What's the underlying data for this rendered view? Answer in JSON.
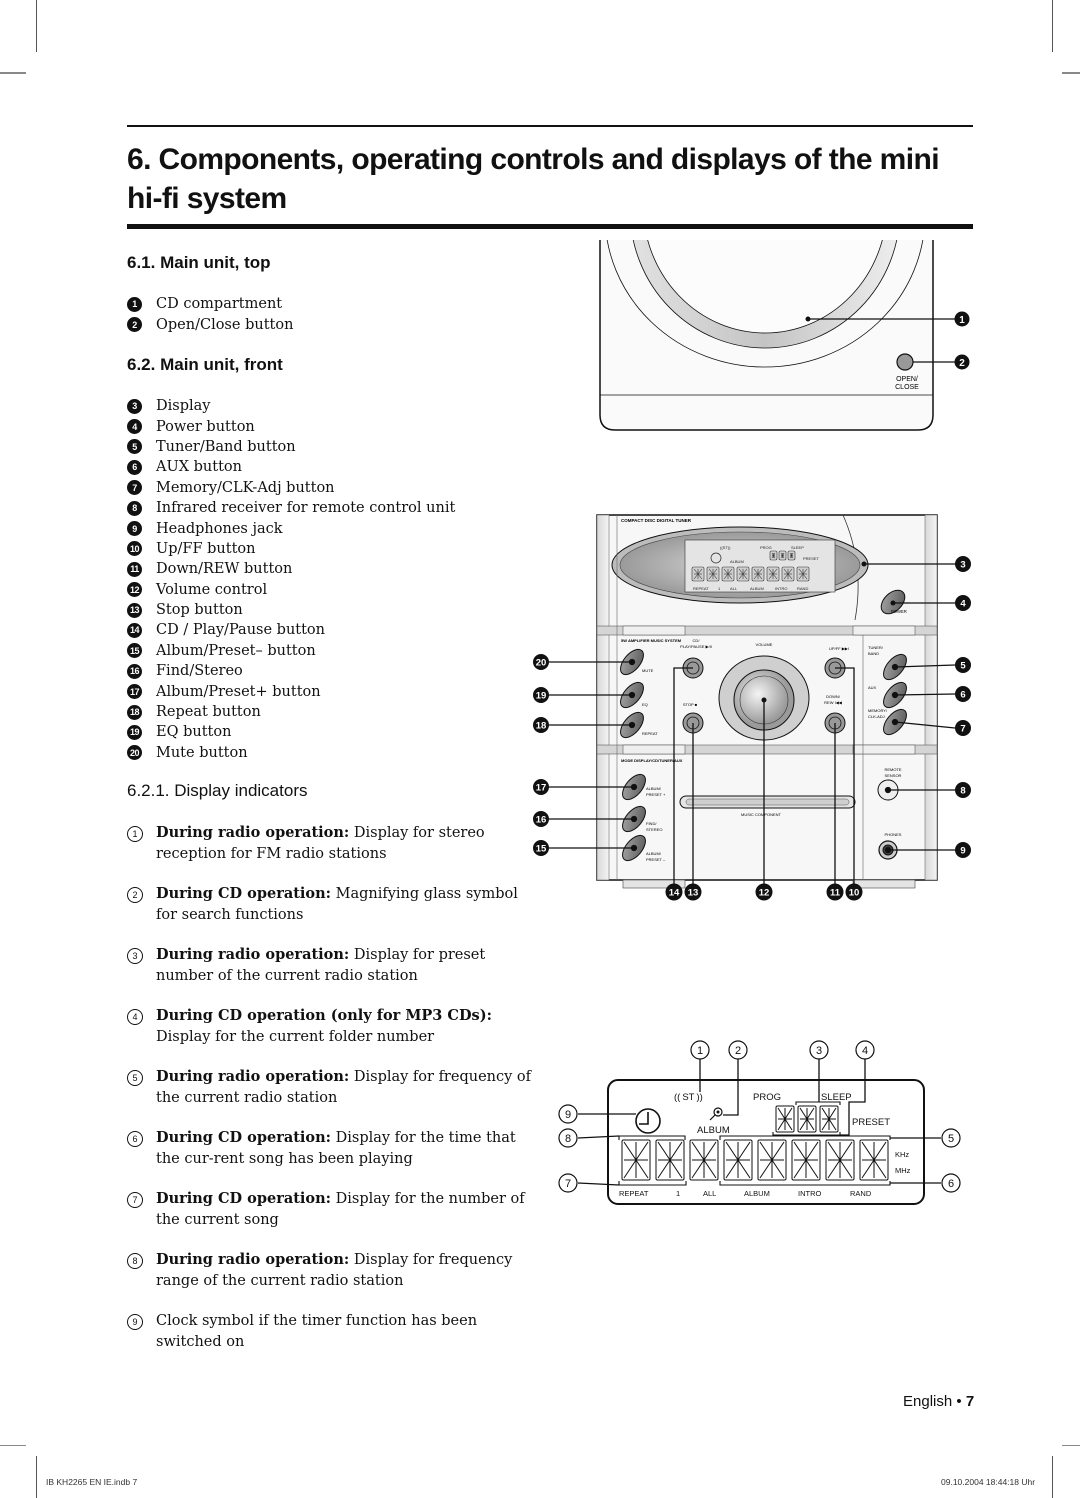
{
  "page": {
    "title": "6. Components, operating controls and displays of the mini hi-fi system",
    "footer": {
      "language": "English",
      "separator": "•",
      "page_number": "7"
    },
    "slug_left": "IB KH2265 EN IE.indb   7",
    "slug_right": "09.10.2004   18:44:18 Uhr"
  },
  "section_top": {
    "heading": "6.1. Main unit, top",
    "items": [
      {
        "num": "1",
        "label": "CD compartment"
      },
      {
        "num": "2",
        "label": "Open/Close button"
      }
    ]
  },
  "section_front": {
    "heading": "6.2. Main unit, front",
    "items": [
      {
        "num": "3",
        "label": "Display"
      },
      {
        "num": "4",
        "label": "Power button"
      },
      {
        "num": "5",
        "label": "Tuner/Band button"
      },
      {
        "num": "6",
        "label": "AUX button"
      },
      {
        "num": "7",
        "label": "Memory/CLK-Adj button"
      },
      {
        "num": "8",
        "label": "Infrared receiver for remote control unit"
      },
      {
        "num": "9",
        "label": "Headphones jack"
      },
      {
        "num": "10",
        "label": "Up/FF button"
      },
      {
        "num": "11",
        "label": "Down/REW button"
      },
      {
        "num": "12",
        "label": "Volume control"
      },
      {
        "num": "13",
        "label": "Stop button"
      },
      {
        "num": "14",
        "label": "CD / Play/Pause button"
      },
      {
        "num": "15",
        "label": "Album/Preset– button"
      },
      {
        "num": "16",
        "label": "Find/Stereo"
      },
      {
        "num": "17",
        "label": "Album/Preset+ button"
      },
      {
        "num": "18",
        "label": "Repeat button"
      },
      {
        "num": "19",
        "label": "EQ button"
      },
      {
        "num": "20",
        "label": "Mute button"
      }
    ]
  },
  "section_display": {
    "heading": "6.2.1. Display indicators",
    "items": [
      {
        "num": "1",
        "bold": "During radio operation:",
        "text": " Display for stereo reception for FM radio stations"
      },
      {
        "num": "2",
        "bold": "During CD operation:",
        "text": " Magnifying glass symbol for search functions"
      },
      {
        "num": "3",
        "bold": "During radio operation:",
        "text": " Display for preset number of the current radio station"
      },
      {
        "num": "4",
        "bold": "During CD operation (only for MP3 CDs):",
        "text": " Display for the current folder number"
      },
      {
        "num": "5",
        "bold": "During radio operation:",
        "text": " Display for frequency of the current radio station"
      },
      {
        "num": "6",
        "bold": "During CD operation:",
        "text": " Display for the time that the cur-rent song has been playing"
      },
      {
        "num": "7",
        "bold": "During CD operation:",
        "text": " Display for the number of the current song"
      },
      {
        "num": "8",
        "bold": "During radio operation:",
        "text": " Display for frequency range of the current radio station"
      },
      {
        "num": "9",
        "bold": "",
        "text": "Clock symbol if the timer function has been switched on"
      }
    ]
  },
  "figure_top": {
    "button_label_1": "OPEN/",
    "button_label_2": "CLOSE",
    "callouts": [
      "1",
      "2"
    ]
  },
  "figure_front": {
    "brand_label": "COMPACT DISC DIGITAL TUNER",
    "amp_label": "5W AMPLIFIER MUSIC SYSTEM",
    "mode_label": "MODE DISPLAY/CD/TUNER/AUX",
    "music_label": "MUSIC COMPONENT",
    "volume_label": "VOLUME",
    "buttons": {
      "power": "POWER",
      "mute": "MUTE",
      "eq": "EQ",
      "repeat": "REPEAT",
      "cd_play_1": "CD/",
      "cd_play_2": "PLAY/PAUSE ▶/II",
      "stop": "STOP ■",
      "up_ff": "UP/FF ▶▶I",
      "down_rew_1": "DOWN/",
      "down_rew_2": "REW I◀◀",
      "tuner_1": "TUNER/",
      "tuner_2": "BAND",
      "aux": "AUX",
      "memory_1": "MEMORY/",
      "memory_2": "CLK-ADJ",
      "album_plus_1": "ALBUM/",
      "album_plus_2": "PRESET +",
      "find_1": "FIND/",
      "find_2": "STEREO",
      "album_minus_1": "ALBUM/",
      "album_minus_2": "PRESET –",
      "remote_1": "REMOTE",
      "remote_2": "SENSOR",
      "phones": "PHONES"
    },
    "callouts_right": [
      "3",
      "4",
      "5",
      "6",
      "7",
      "8",
      "9"
    ],
    "callouts_left": [
      "20",
      "19",
      "18",
      "17",
      "16",
      "15"
    ],
    "callouts_bottom": [
      "14",
      "13",
      "12",
      "11",
      "10"
    ]
  },
  "figure_display": {
    "st": "ST",
    "prog": "PROG",
    "sleep": "SLEEP",
    "preset": "PRESET",
    "album": "ALBUM",
    "khz": "KHz",
    "mhz": "MHz",
    "bottom_labels": [
      "REPEAT",
      "1",
      "ALL",
      "ALBUM",
      "INTRO",
      "RAND"
    ],
    "callouts_top": [
      "1",
      "2",
      "3",
      "4"
    ],
    "callouts_left": [
      "9",
      "8",
      "7"
    ],
    "callouts_right": [
      "5",
      "6"
    ]
  }
}
